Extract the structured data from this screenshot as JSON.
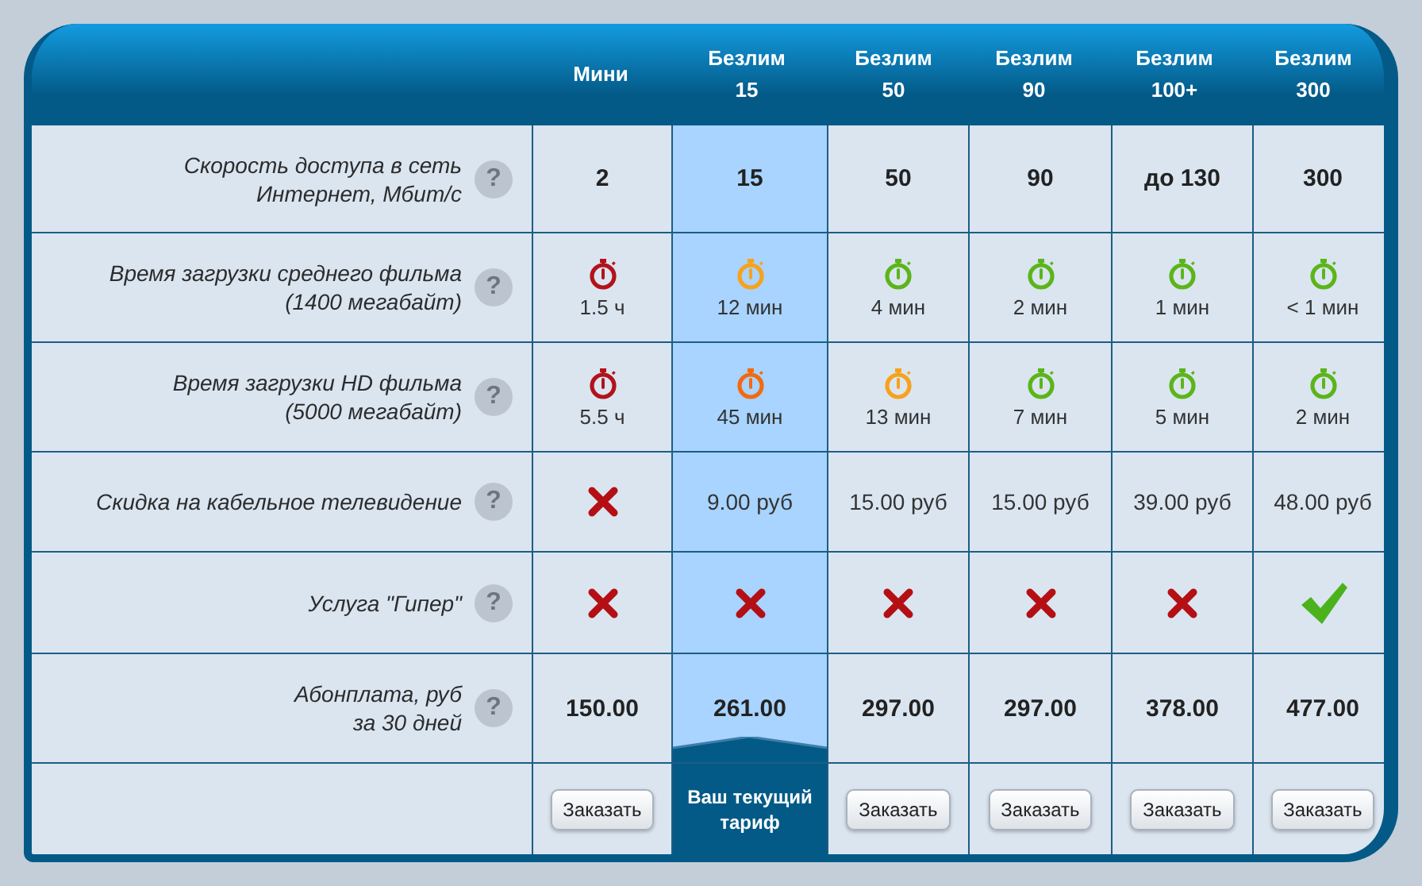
{
  "plans": [
    {
      "name": "Мини",
      "current": false
    },
    {
      "name": "Безлим 15",
      "current": true
    },
    {
      "name": "Безлим 50",
      "current": false
    },
    {
      "name": "Безлим 90",
      "current": false
    },
    {
      "name": "Безлим 100+",
      "current": false
    },
    {
      "name": "Безлим 300",
      "current": false
    }
  ],
  "rows": [
    {
      "label": "Скорость доступа в сеть\nИнтернет, Мбит/с",
      "help": "?",
      "cells": [
        {
          "kind": "value",
          "text": "2"
        },
        {
          "kind": "value",
          "text": "15"
        },
        {
          "kind": "value",
          "text": "50"
        },
        {
          "kind": "value",
          "text": "90"
        },
        {
          "kind": "value",
          "text": "до 130"
        },
        {
          "kind": "value",
          "text": "300"
        }
      ]
    },
    {
      "label": "Время загрузки среднего фильма\n(1400 мегабайт)",
      "help": "?",
      "cells": [
        {
          "kind": "timer",
          "color": "#b3121b",
          "text": "1.5 ч"
        },
        {
          "kind": "timer",
          "color": "#f7a21b",
          "text": "12 мин"
        },
        {
          "kind": "timer",
          "color": "#5bb51a",
          "text": "4 мин"
        },
        {
          "kind": "timer",
          "color": "#5bb51a",
          "text": "2 мин"
        },
        {
          "kind": "timer",
          "color": "#5bb51a",
          "text": "1 мин"
        },
        {
          "kind": "timer",
          "color": "#5bb51a",
          "text": "< 1 мин"
        }
      ]
    },
    {
      "label": "Время загрузки HD фильма\n(5000 мегабайт)",
      "help": "?",
      "cells": [
        {
          "kind": "timer",
          "color": "#b3121b",
          "text": "5.5 ч"
        },
        {
          "kind": "timer",
          "color": "#f26a10",
          "text": "45 мин"
        },
        {
          "kind": "timer",
          "color": "#f7a21b",
          "text": "13 мин"
        },
        {
          "kind": "timer",
          "color": "#5bb51a",
          "text": "7 мин"
        },
        {
          "kind": "timer",
          "color": "#5bb51a",
          "text": "5 мин"
        },
        {
          "kind": "timer",
          "color": "#5bb51a",
          "text": "2 мин"
        }
      ]
    },
    {
      "label": "Скидка на кабельное телевидение",
      "help": "?",
      "cells": [
        {
          "kind": "no"
        },
        {
          "kind": "text",
          "text": "9.00 руб"
        },
        {
          "kind": "text",
          "text": "15.00 руб"
        },
        {
          "kind": "text",
          "text": "15.00 руб"
        },
        {
          "kind": "text",
          "text": "39.00 руб"
        },
        {
          "kind": "text",
          "text": "48.00 руб"
        }
      ]
    },
    {
      "label": "Услуга \"Гипер\"",
      "help": "?",
      "cells": [
        {
          "kind": "no"
        },
        {
          "kind": "no"
        },
        {
          "kind": "no"
        },
        {
          "kind": "no"
        },
        {
          "kind": "no"
        },
        {
          "kind": "yes"
        }
      ]
    },
    {
      "label": "Абонплата, руб\nза 30 дней",
      "help": "?",
      "cells": [
        {
          "kind": "value",
          "text": "150.00"
        },
        {
          "kind": "value",
          "text": "261.00"
        },
        {
          "kind": "value",
          "text": "297.00"
        },
        {
          "kind": "value",
          "text": "297.00"
        },
        {
          "kind": "value",
          "text": "378.00"
        },
        {
          "kind": "value",
          "text": "477.00"
        }
      ]
    }
  ],
  "actions": [
    {
      "label": "Заказать"
    },
    {
      "label": "Ваш текущий тариф"
    },
    {
      "label": "Заказать"
    },
    {
      "label": "Заказать"
    },
    {
      "label": "Заказать"
    },
    {
      "label": "Заказать"
    }
  ]
}
